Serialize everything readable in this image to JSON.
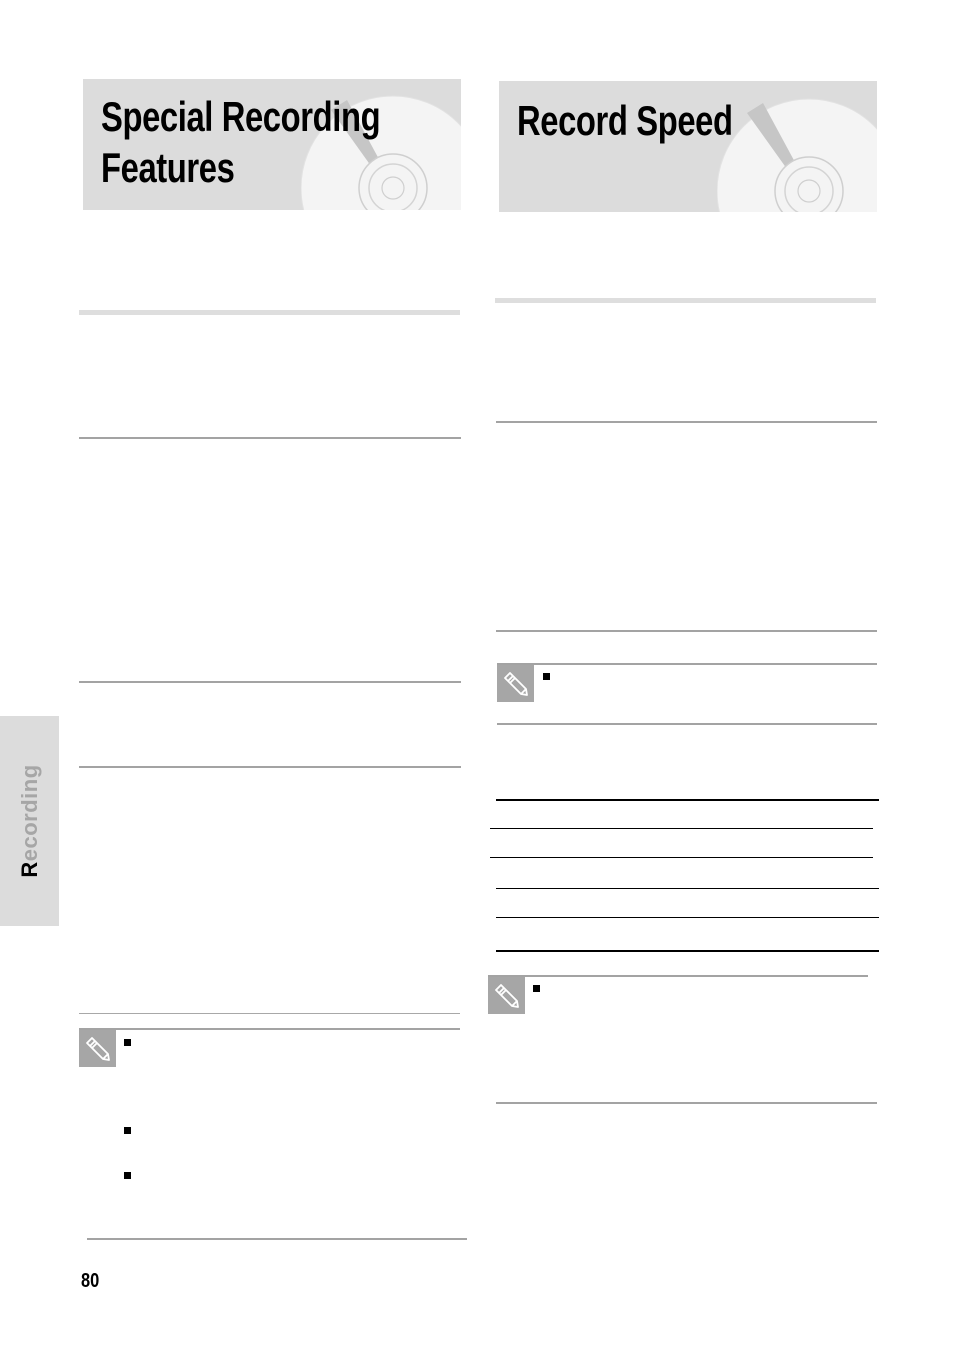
{
  "left_column": {
    "title_line1": "Special Recording",
    "title_line2": "Features",
    "title_icon": "disc-icon",
    "note_icon": "pencil-note-icon",
    "note_bullets": 3
  },
  "right_column": {
    "title": "Record Speed",
    "title_icon": "disc-icon",
    "note_icon": "pencil-note-icon",
    "notes": 2,
    "table_rows": 5
  },
  "sidebar_tab": {
    "label_first": "R",
    "label_rest": "ecording"
  },
  "footer": {
    "page_number": "80"
  },
  "colors": {
    "title_bg": "#dcdcdc",
    "rule": "#a3a3a3",
    "note_icon_bg": "#a6a6a6",
    "sidebar_label": "#a6a6a6"
  }
}
